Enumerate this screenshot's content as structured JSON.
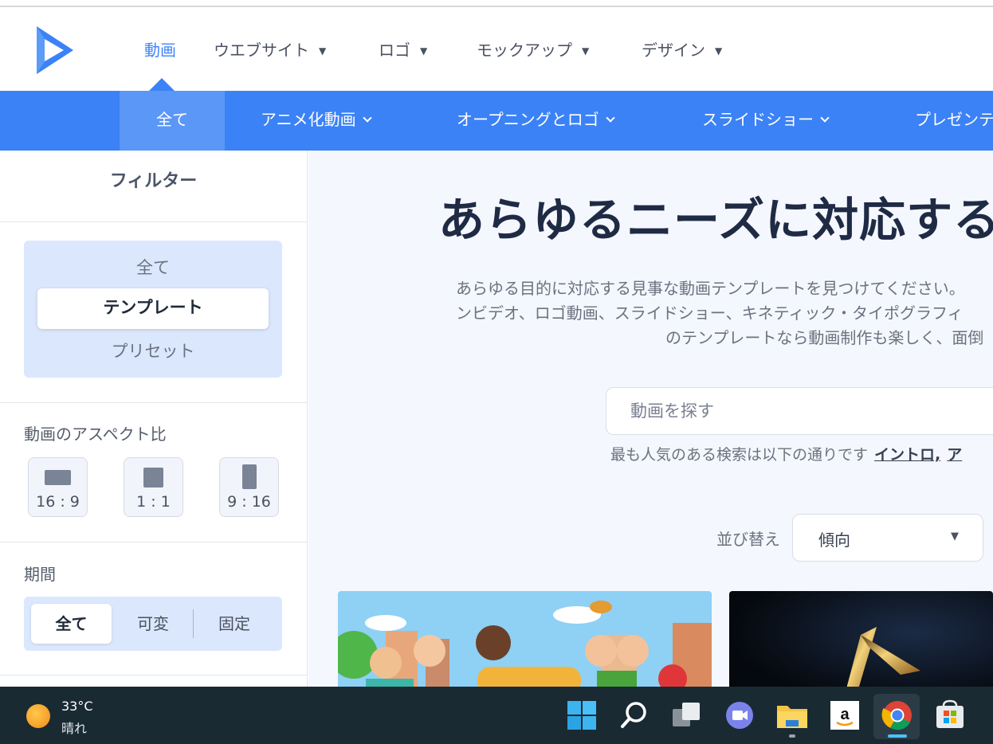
{
  "header": {
    "nav": [
      {
        "label": "動画",
        "active": true
      },
      {
        "label": "ウエブサイト"
      },
      {
        "label": "ロゴ"
      },
      {
        "label": "モックアップ"
      },
      {
        "label": "デザイン"
      }
    ]
  },
  "subnav": {
    "items": [
      {
        "label": "全て",
        "active": true
      },
      {
        "label": "アニメ化動画"
      },
      {
        "label": "オープニングとロゴ"
      },
      {
        "label": "スライドショー"
      },
      {
        "label": "プレゼンテ"
      }
    ]
  },
  "sidebar": {
    "title": "フィルター",
    "type_options": [
      "全て",
      "テンプレート",
      "プリセット"
    ],
    "type_selected": "テンプレート",
    "aspect_label": "動画のアスペクト比",
    "aspect_ratios": [
      "16 : 9",
      "1 : 1",
      "9 : 16"
    ],
    "duration_label": "期間",
    "duration_options": [
      "全て",
      "可変",
      "固定"
    ],
    "duration_selected": "全て"
  },
  "main": {
    "title": "あらゆるニーズに対応する",
    "desc_lines": [
      "あらゆる目的に対応する見事な動画テンプレートを見つけてください。",
      "ンビデオ、ロゴ動画、スライドショー、キネティック・タイポグラフィ",
      "のテンプレートなら動画制作も楽しく、面倒"
    ],
    "search_placeholder": "動画を探す",
    "popular_text": "最も人気のある検索は以下の通りです",
    "popular_links": [
      "イントロ,",
      "ア"
    ],
    "sort_label": "並び替え",
    "sort_value": "傾向"
  },
  "taskbar": {
    "temperature": "33°C",
    "condition": "晴れ"
  },
  "colors": {
    "accent": "#3b82f6",
    "nav_active": "#3f83f8",
    "taskbar": "#1a2a33"
  }
}
